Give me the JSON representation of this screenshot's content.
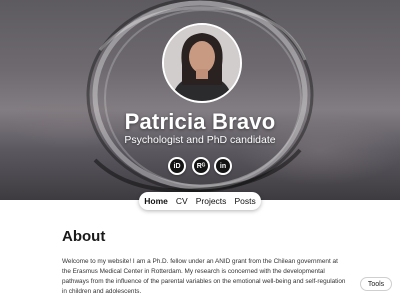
{
  "profile": {
    "name": "Patricia Bravo",
    "subtitle": "Psychologist and PhD candidate"
  },
  "social_links": [
    {
      "icon": "orcid-icon",
      "glyph": "iD"
    },
    {
      "icon": "researchgate-icon",
      "glyph": "Rᴳ"
    },
    {
      "icon": "linkedin-icon",
      "glyph": "in"
    }
  ],
  "nav": {
    "items": [
      "Home",
      "CV",
      "Projects",
      "Posts"
    ],
    "active": "Home"
  },
  "about": {
    "title": "About",
    "text": "Welcome to my website! I am a Ph.D. fellow under an ANID grant from the Chilean government at the Erasmus Medical Center in Rotterdam. My research is concerned with the developmental pathways from the influence of the parental variables on the emotional well-being and self-regulation in children and adolescents."
  },
  "tools_button": "Tools",
  "colors": {
    "hero_overlay": "#5d5a60",
    "nav_background": "#ffffff",
    "text": "#1a1a1a"
  }
}
